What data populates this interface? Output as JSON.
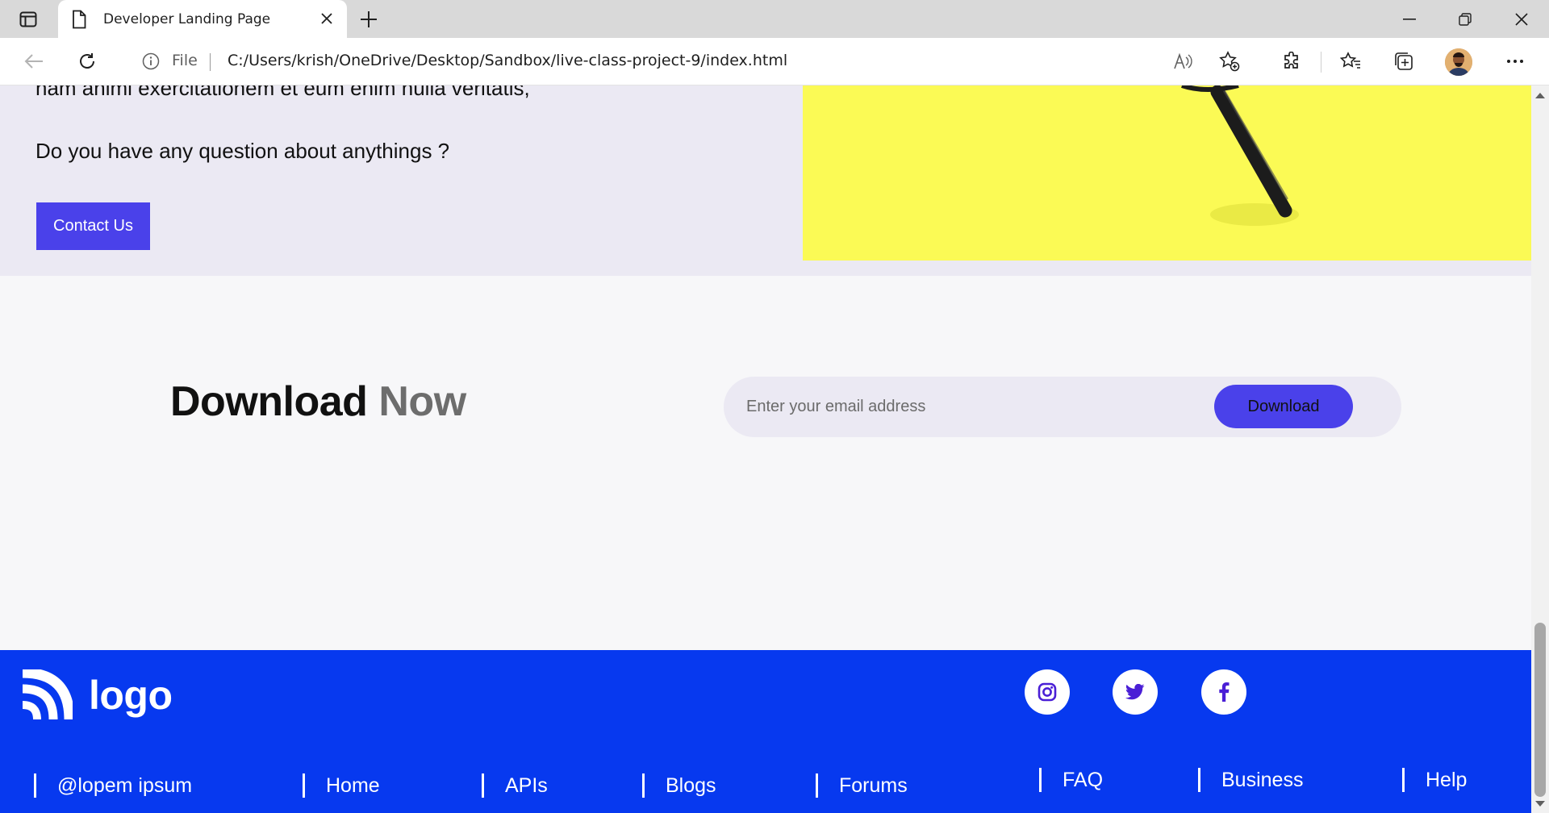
{
  "browser": {
    "tab_title": "Developer Landing Page",
    "address_scheme": "File",
    "address_url": "C:/Users/krish/OneDrive/Desktop/Sandbox/live-class-project-9/index.html"
  },
  "contact": {
    "cut_text": "nam animi exercitationem et eum enim nulla veritatis,",
    "question": "Do you have any question about anythings ?",
    "button_label": "Contact Us"
  },
  "download": {
    "heading_main": "Download",
    "heading_accent": "Now",
    "email_placeholder": "Enter your email address",
    "button_label": "Download"
  },
  "footer": {
    "logo_text": "logo",
    "social": [
      "instagram-icon",
      "twitter-icon",
      "facebook-icon"
    ],
    "links": [
      "@lopem ipsum",
      "Home",
      "APIs",
      "Blogs",
      "Forums",
      "FAQ",
      "Business",
      "Help"
    ]
  },
  "colors": {
    "primary": "#4a41ea",
    "footer_bg": "#0739ef",
    "section_bg": "#ebe9f3",
    "image_yellow": "#fbfa55"
  }
}
